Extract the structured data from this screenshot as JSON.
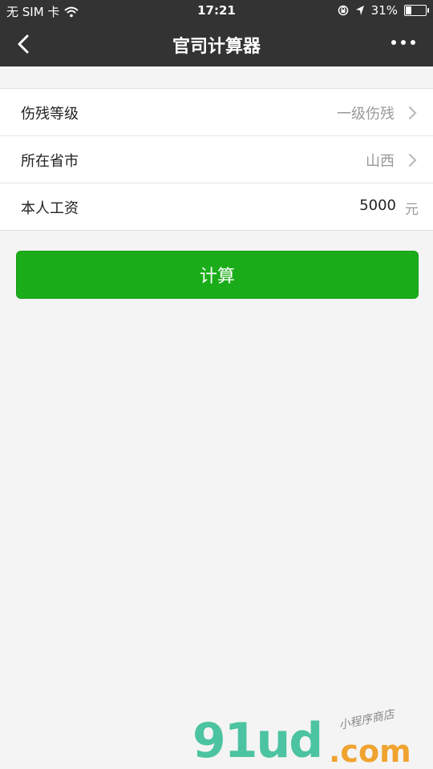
{
  "status_bar": {
    "carrier": "无 SIM 卡",
    "time": "17:21",
    "battery_text": "31%",
    "battery_level": 0.31
  },
  "nav": {
    "title": "官司计算器"
  },
  "form": {
    "rows": [
      {
        "label": "伤残等级",
        "value": "一级伤残"
      },
      {
        "label": "所在省市",
        "value": "山西"
      },
      {
        "label": "本人工资",
        "value": "5000",
        "unit": "元"
      }
    ]
  },
  "button": {
    "label": "计算"
  },
  "watermark": {
    "main": "91ud",
    "domain": ".com",
    "subtitle": "小程序商店"
  },
  "colors": {
    "nav_bg": "#333333",
    "button_bg": "#1aad19",
    "page_bg": "#f4f4f4"
  }
}
